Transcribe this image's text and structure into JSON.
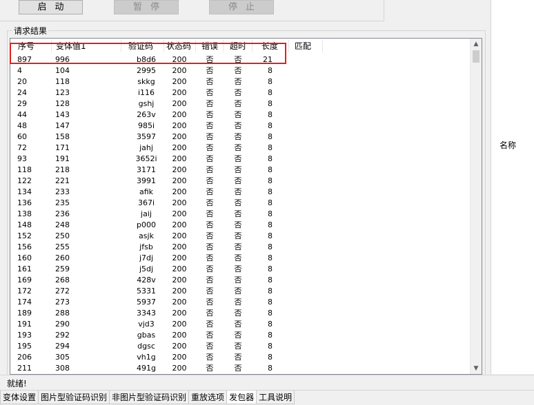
{
  "toolbar": {
    "start_label": "启动",
    "pause_label": "暂停",
    "stop_label": "停止"
  },
  "results_group": {
    "title": "请求结果"
  },
  "table": {
    "columns": [
      "序号",
      "变体值1",
      "验证码",
      "状态码",
      "错误",
      "超时",
      "长度",
      "匹配"
    ],
    "rows": [
      [
        "897",
        "996",
        "b8d6",
        "200",
        "否",
        "否",
        "21"
      ],
      [
        "4",
        "104",
        "2995",
        "200",
        "否",
        "否",
        "8"
      ],
      [
        "20",
        "118",
        "skkg",
        "200",
        "否",
        "否",
        "8"
      ],
      [
        "24",
        "123",
        "i116",
        "200",
        "否",
        "否",
        "8"
      ],
      [
        "29",
        "128",
        "gshj",
        "200",
        "否",
        "否",
        "8"
      ],
      [
        "44",
        "143",
        "263v",
        "200",
        "否",
        "否",
        "8"
      ],
      [
        "48",
        "147",
        "985i",
        "200",
        "否",
        "否",
        "8"
      ],
      [
        "60",
        "158",
        "3597",
        "200",
        "否",
        "否",
        "8"
      ],
      [
        "72",
        "171",
        "jahj",
        "200",
        "否",
        "否",
        "8"
      ],
      [
        "93",
        "191",
        "3652i",
        "200",
        "否",
        "否",
        "8"
      ],
      [
        "118",
        "218",
        "3171",
        "200",
        "否",
        "否",
        "8"
      ],
      [
        "122",
        "221",
        "3991",
        "200",
        "否",
        "否",
        "8"
      ],
      [
        "134",
        "233",
        "afik",
        "200",
        "否",
        "否",
        "8"
      ],
      [
        "136",
        "235",
        "367i",
        "200",
        "否",
        "否",
        "8"
      ],
      [
        "138",
        "236",
        "jaij",
        "200",
        "否",
        "否",
        "8"
      ],
      [
        "148",
        "248",
        "p000",
        "200",
        "否",
        "否",
        "8"
      ],
      [
        "152",
        "250",
        "asjk",
        "200",
        "否",
        "否",
        "8"
      ],
      [
        "156",
        "255",
        "jfsb",
        "200",
        "否",
        "否",
        "8"
      ],
      [
        "160",
        "260",
        "j7dj",
        "200",
        "否",
        "否",
        "8"
      ],
      [
        "161",
        "259",
        "j5dj",
        "200",
        "否",
        "否",
        "8"
      ],
      [
        "169",
        "268",
        "428v",
        "200",
        "否",
        "否",
        "8"
      ],
      [
        "172",
        "272",
        "5331",
        "200",
        "否",
        "否",
        "8"
      ],
      [
        "174",
        "273",
        "5937",
        "200",
        "否",
        "否",
        "8"
      ],
      [
        "189",
        "288",
        "3343",
        "200",
        "否",
        "否",
        "8"
      ],
      [
        "191",
        "290",
        "vjd3",
        "200",
        "否",
        "否",
        "8"
      ],
      [
        "193",
        "292",
        "gbas",
        "200",
        "否",
        "否",
        "8"
      ],
      [
        "195",
        "294",
        "dgsc",
        "200",
        "否",
        "否",
        "8"
      ],
      [
        "206",
        "305",
        "vh1g",
        "200",
        "否",
        "否",
        "8"
      ],
      [
        "211",
        "308",
        "491g",
        "200",
        "否",
        "否",
        "8"
      ]
    ]
  },
  "scrollbar": {
    "up_icon": "▲",
    "down_icon": "▼"
  },
  "right_panel": {
    "label": "名称"
  },
  "status_bar": {
    "text": "就绪!"
  },
  "tabs": [
    {
      "label": "变体设置",
      "active": false
    },
    {
      "label": "图片型验证码识别",
      "active": false
    },
    {
      "label": "非图片型验证码识别",
      "active": false
    },
    {
      "label": "重放选项",
      "active": false
    },
    {
      "label": "发包器",
      "active": true
    },
    {
      "label": "工具说明",
      "active": false
    }
  ],
  "colors": {
    "highlight": "#e02020",
    "background": "#f0f0f0"
  }
}
